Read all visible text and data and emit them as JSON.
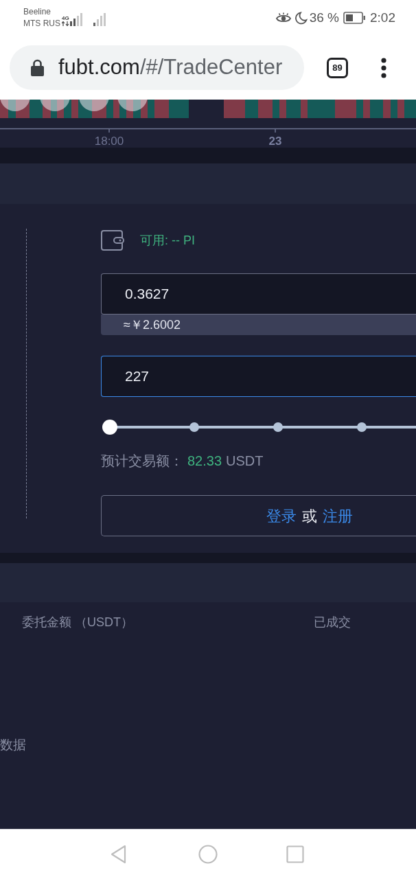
{
  "status_bar": {
    "carriers": [
      "Beeline",
      "MTS RUS"
    ],
    "network": "4G",
    "battery": "36 %",
    "time": "2:02"
  },
  "browser": {
    "url_host": "fubt.com",
    "url_path": "/#/TradeCenter",
    "tab_count": "89"
  },
  "chart": {
    "time_labels": [
      {
        "label": "18:00",
        "kind": "time"
      },
      {
        "label": "23",
        "kind": "day"
      }
    ]
  },
  "order_form": {
    "available": "可用: -- PI",
    "price": {
      "value": "0.3627",
      "focused": false
    },
    "price_estimate": "≈￥2.6002",
    "amount": {
      "value": "227",
      "focused": true
    },
    "slider": {
      "level": 0
    },
    "estimate": {
      "label": "预计交易额：",
      "value": "82.33",
      "unit": "USDT"
    },
    "auth": [
      {
        "kind": "link",
        "text": "登录"
      },
      {
        "kind": "text",
        "text": "或"
      },
      {
        "kind": "link",
        "text": "注册"
      }
    ]
  },
  "orders": {
    "columns": [
      "委托金额 （USDT）",
      "已成交"
    ],
    "empty_text": "数据"
  }
}
